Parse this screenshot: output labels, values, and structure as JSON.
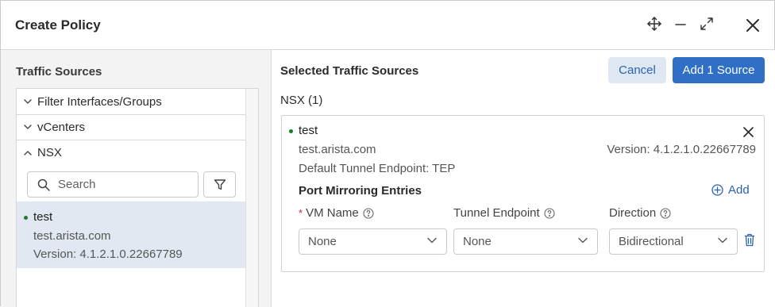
{
  "dialog": {
    "title": "Create Policy"
  },
  "left": {
    "title": "Traffic Sources",
    "groups": [
      {
        "label": "Filter Interfaces/Groups",
        "expanded": false
      },
      {
        "label": "vCenters",
        "expanded": false
      },
      {
        "label": "NSX",
        "expanded": true
      }
    ],
    "search": {
      "placeholder": "Search",
      "value": ""
    },
    "item": {
      "name": "test",
      "host": "test.arista.com",
      "version": "Version: 4.1.2.1.0.22667789"
    }
  },
  "right": {
    "title": "Selected Traffic Sources",
    "cancel_label": "Cancel",
    "add_label": "Add 1 Source",
    "group_count": "NSX (1)",
    "card": {
      "name": "test",
      "host": "test.arista.com",
      "version": "Version: 4.1.2.1.0.22667789",
      "tep": "Default Tunnel Endpoint: TEP",
      "pm_title": "Port Mirroring Entries",
      "add_label": "Add",
      "columns": {
        "vm_name": "VM Name",
        "tunnel_endpoint": "Tunnel Endpoint",
        "direction": "Direction"
      },
      "required_mark": "*",
      "row": {
        "vm_name": "None",
        "tunnel_endpoint": "None",
        "direction": "Bidirectional"
      }
    }
  },
  "colors": {
    "accent": "#2f6fc6",
    "accent_text": "#2a62b5",
    "status_dot": "#1c7a2c",
    "selected_row": "#e2e8f1"
  }
}
